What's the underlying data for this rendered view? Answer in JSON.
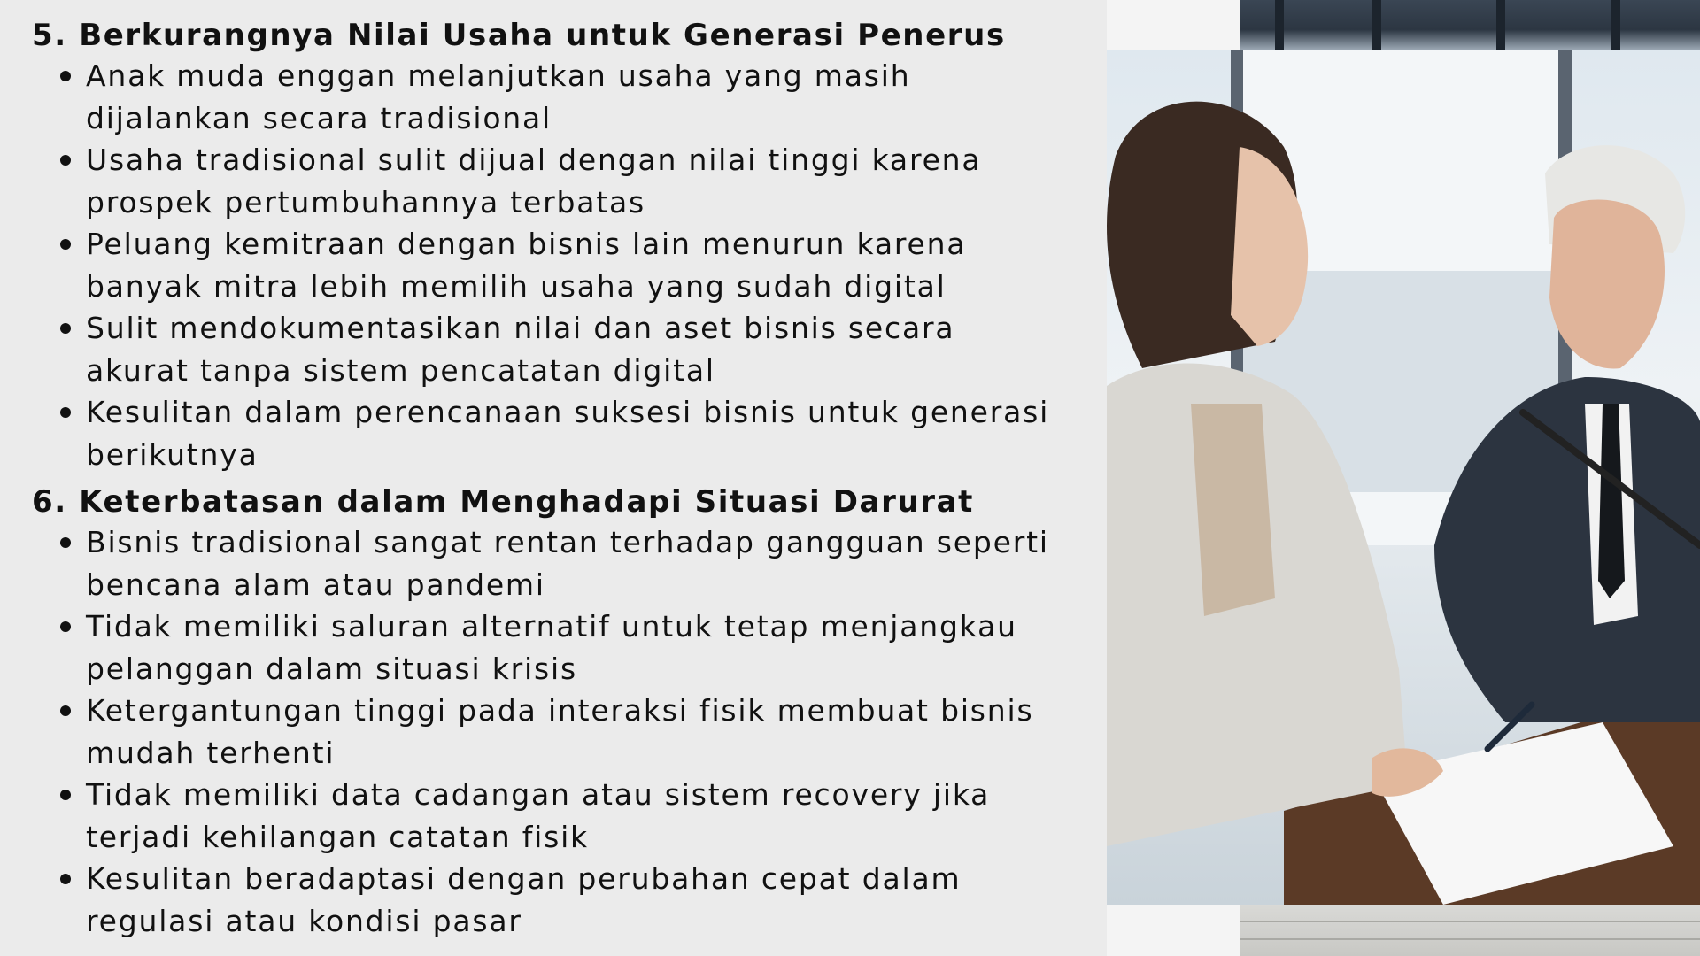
{
  "sections": [
    {
      "title": "5. Berkurangnya Nilai Usaha untuk Generasi Penerus",
      "items": [
        {
          "line1": "Anak muda enggan melanjutkan usaha yang masih",
          "line2": "dijalankan secara tradisional"
        },
        {
          "line1": "Usaha tradisional sulit dijual dengan nilai tinggi karena",
          "line2": "prospek pertumbuhannya terbatas"
        },
        {
          "line1": "Peluang kemitraan dengan bisnis lain menurun karena",
          "line2": "banyak mitra lebih memilih usaha yang sudah digital"
        },
        {
          "line1": "Sulit mendokumentasikan nilai dan aset bisnis secara",
          "line2": "akurat tanpa sistem pencatatan digital"
        },
        {
          "line1": "Kesulitan dalam perencanaan suksesi bisnis untuk generasi",
          "line2": "berikutnya"
        }
      ]
    },
    {
      "title": "6. Keterbatasan dalam Menghadapi Situasi Darurat",
      "items": [
        {
          "line1": "Bisnis tradisional sangat rentan terhadap gangguan seperti",
          "line2": "bencana alam atau pandemi"
        },
        {
          "line1": "Tidak memiliki saluran alternatif untuk tetap menjangkau",
          "line2": "pelanggan dalam situasi krisis"
        },
        {
          "line1": "Ketergantungan tinggi pada interaksi fisik membuat bisnis",
          "line2": "mudah terhenti"
        },
        {
          "line1": "Tidak memiliki data cadangan atau sistem recovery jika",
          "line2": "terjadi kehilangan catatan fisik"
        },
        {
          "line1": "Kesulitan beradaptasi dengan perubahan cepat dalam",
          "line2": "regulasi atau kondisi pasar"
        }
      ]
    }
  ],
  "colors": {
    "background": "#ebebeb",
    "text": "#111111"
  }
}
